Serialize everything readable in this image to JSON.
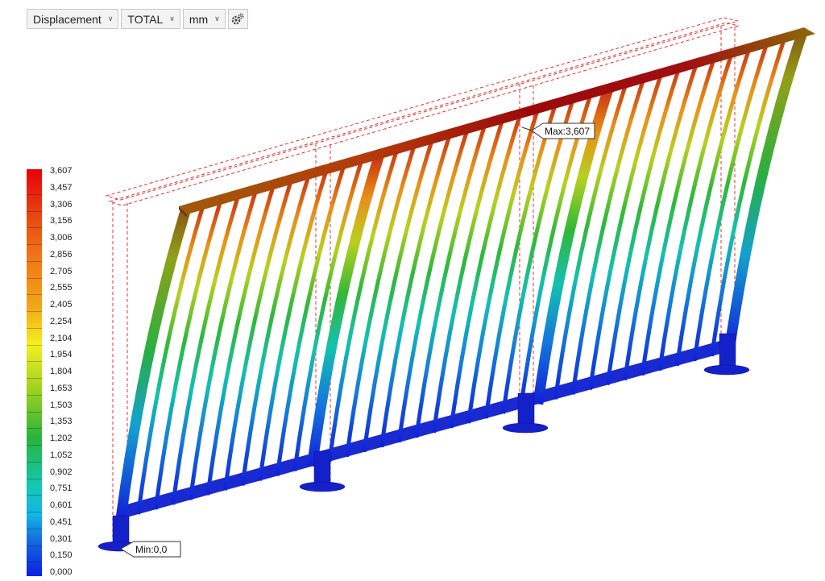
{
  "toolbar": {
    "result_type": "Displacement",
    "component": "TOTAL",
    "unit": "mm",
    "settings_icon": "gear-icon"
  },
  "legend": {
    "values": [
      "3,607",
      "3,457",
      "3,306",
      "3,156",
      "3,006",
      "2,856",
      "2,705",
      "2,555",
      "2,405",
      "2,254",
      "2,104",
      "1,954",
      "1,804",
      "1,653",
      "1,503",
      "1,353",
      "1,202",
      "1,052",
      "0,902",
      "0,751",
      "0,601",
      "0,451",
      "0,301",
      "0,150",
      "0,000"
    ]
  },
  "probes": {
    "max_label": "Max:3,607",
    "min_label": "Min:0,0"
  },
  "colors": {
    "max": "#e8000a",
    "min": "#0a1ee6",
    "undeformed_outline": "#e83030"
  }
}
